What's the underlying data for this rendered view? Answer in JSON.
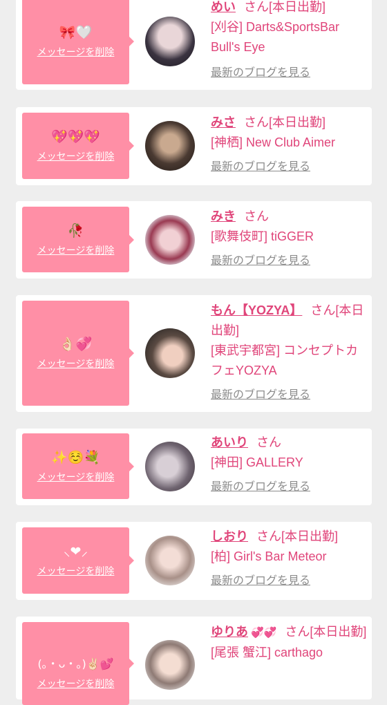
{
  "delete_label": "メッセージを削除",
  "blog_label": "最新のブログを見る",
  "suffix_san": "さん",
  "cards": [
    {
      "emoji": "🎀🤍",
      "name": "めい",
      "status": "[本日出勤]",
      "shop": "[刈谷] Darts&SportsBar Bull's Eye"
    },
    {
      "emoji": "💖💖💖",
      "name": "みさ",
      "status": "[本日出勤]",
      "shop": "[神栖] New Club Aimer"
    },
    {
      "emoji": "🥀",
      "name": "みき",
      "status": "",
      "shop": "[歌舞伎町] tiGGER"
    },
    {
      "emoji": "👌🏻💞",
      "name": "もん【YOZYA】",
      "status": "[本日出勤]",
      "shop": "[東武宇都宮] コンセプトカフェYOZYA"
    },
    {
      "emoji": "✨☺️💐",
      "name": "あいり",
      "status": "",
      "shop": "[神田] GALLERY"
    },
    {
      "emoji": "⸜❤︎⸝",
      "name": "しおり",
      "status": "[本日出勤]",
      "shop": "[柏] Girl's Bar Meteor"
    },
    {
      "emoji": "(｡・ᴗ・｡)✌🏻💕",
      "name": "ゆりあ",
      "name_emoji": "💞💞",
      "status": "[本日出勤]",
      "shop": "[尾張 蟹江] carthago"
    }
  ]
}
